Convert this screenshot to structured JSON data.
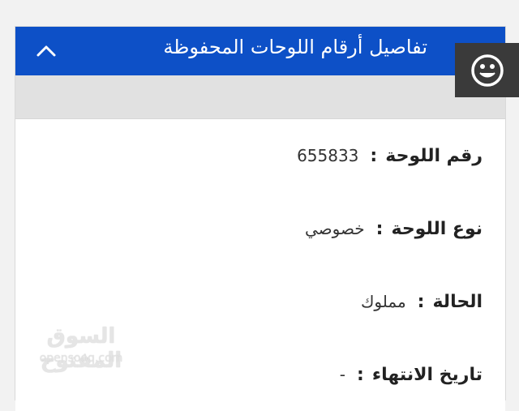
{
  "header": {
    "title": "تفاصيل أرقام اللوحات المحفوظة",
    "collapse_icon": "chevron-up-icon",
    "background": "#0d50c7"
  },
  "details": {
    "plate_number": {
      "label": "رقم اللوحة",
      "colon": ":",
      "value": "655833"
    },
    "plate_type": {
      "label": "نوع اللوحة",
      "colon": ":",
      "value": "خصوصي"
    },
    "status": {
      "label": "الحالة",
      "colon": ":",
      "value": "مملوك"
    },
    "expiry_date": {
      "label": "تاريخ الانتهاء",
      "colon": ":",
      "value": "-"
    }
  },
  "feedback": {
    "icon": "smiley-icon",
    "background": "#3a3a3a"
  },
  "watermark": {
    "arabic": "السوق المفتوح",
    "latin": "opensooq.com"
  }
}
